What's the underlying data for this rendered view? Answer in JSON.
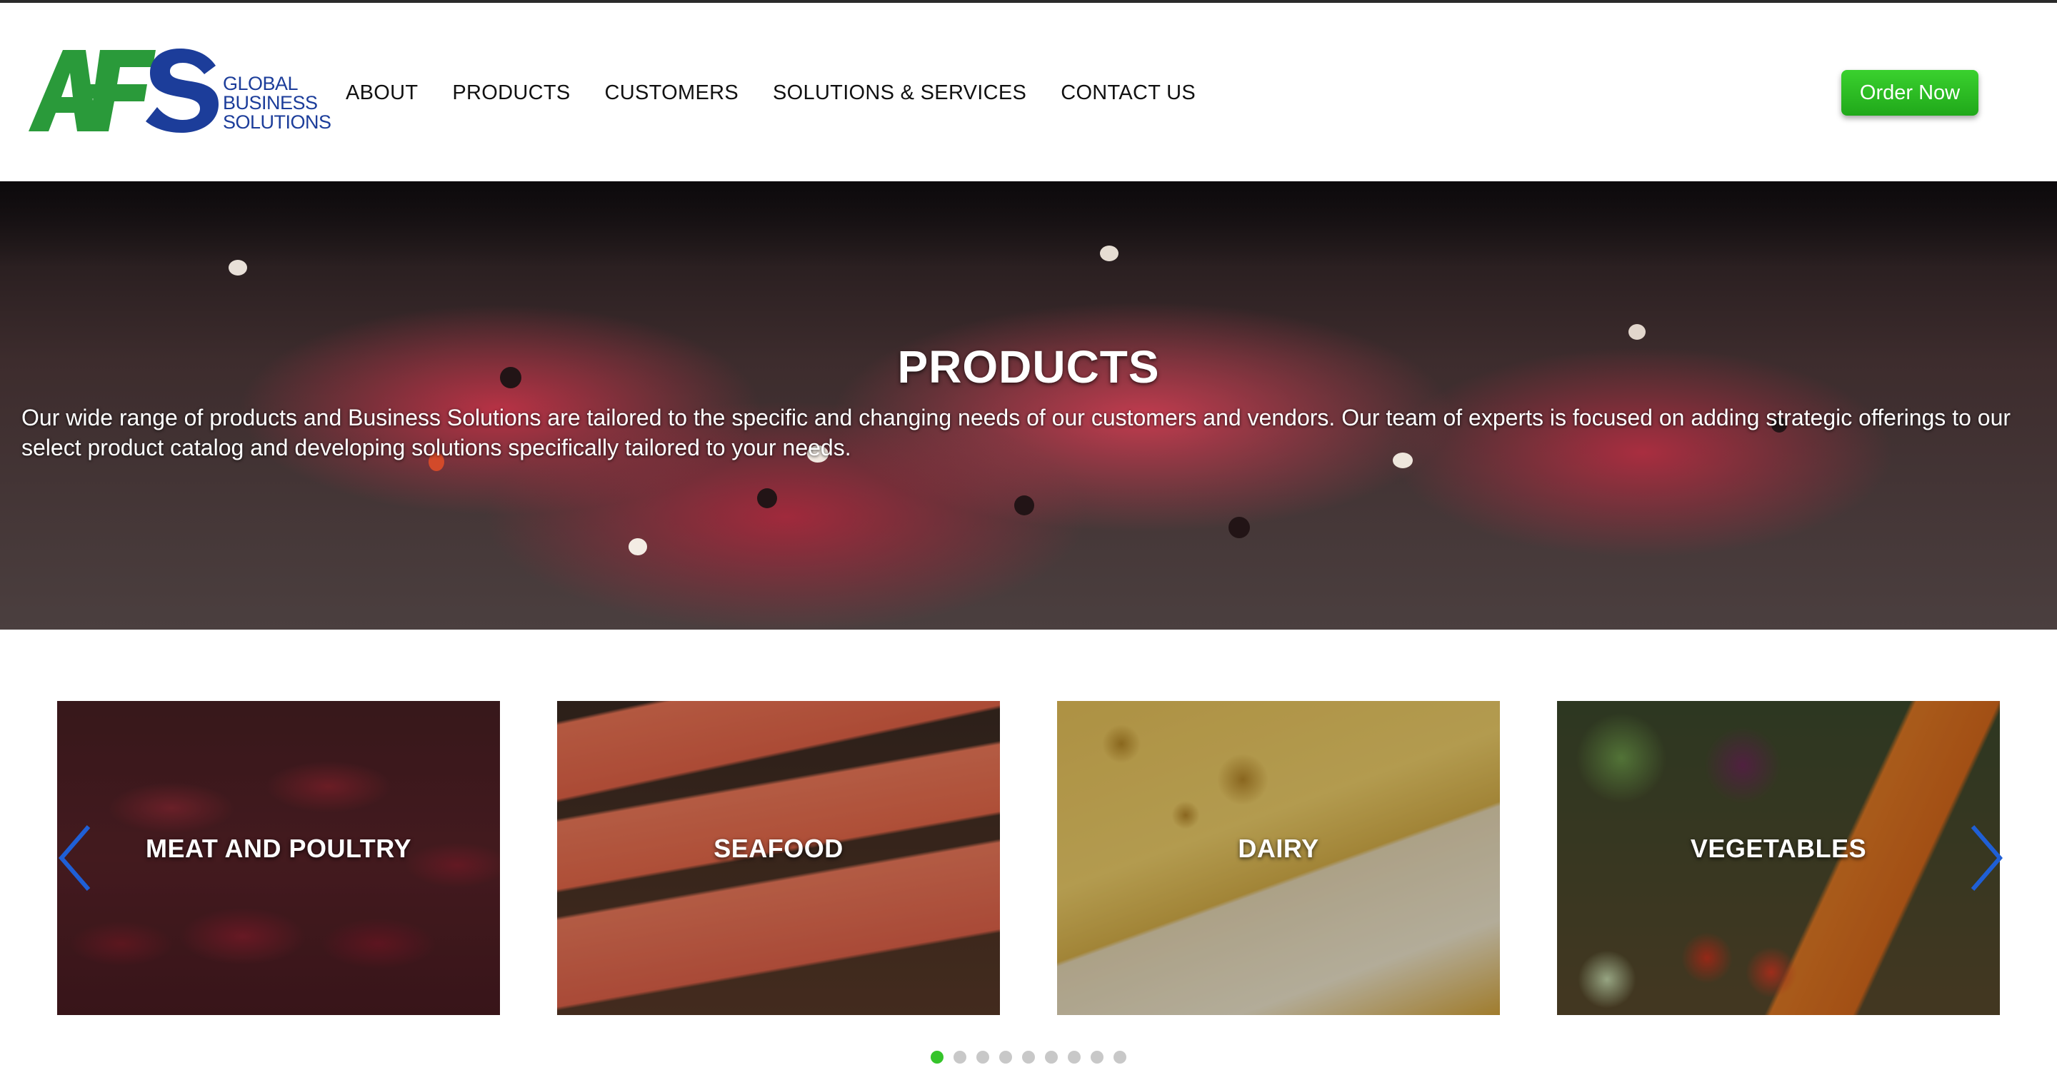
{
  "brand": {
    "logo_letters": "AFS",
    "tagline_lines": [
      "GLOBAL",
      "BUSINESS",
      "SOLUTIONS"
    ],
    "colors": {
      "green": "#2a9a3a",
      "navy": "#1c3d9a"
    }
  },
  "nav": {
    "items": [
      {
        "label": "ABOUT"
      },
      {
        "label": "PRODUCTS"
      },
      {
        "label": "CUSTOMERS"
      },
      {
        "label": "SOLUTIONS & SERVICES"
      },
      {
        "label": "CONTACT US"
      }
    ]
  },
  "order_button": {
    "label": "Order Now",
    "color": "#2bbf22"
  },
  "hero": {
    "title": "PRODUCTS",
    "description": "Our wide range of products and Business Solutions are tailored to the specific and changing needs of our customers and vendors. Our team of experts is focused on adding strategic offerings to our select product catalog and developing solutions specifically tailored to your needs."
  },
  "carousel": {
    "cards": [
      {
        "label": "MEAT AND POULTRY"
      },
      {
        "label": "SEAFOOD"
      },
      {
        "label": "DAIRY"
      },
      {
        "label": "VEGETABLES"
      }
    ],
    "arrows": {
      "prev": "chevron-left-icon",
      "next": "chevron-right-icon",
      "color": "#1f5fd6"
    },
    "page_count": 9,
    "active_page": 1
  }
}
